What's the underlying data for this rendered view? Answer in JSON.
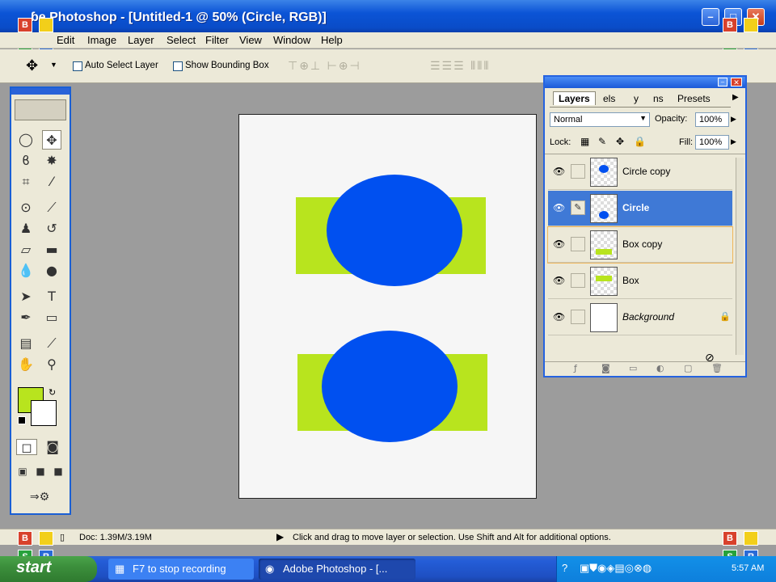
{
  "window": {
    "title": "Adobe Photoshop - [Untitled-1 @ 50% (Circle, RGB)]",
    "title_visible": "ɓe Photoshop - [Untitled-1 @ 50% (Circle, RGB)]"
  },
  "menu": [
    "Edit",
    "Image",
    "Layer",
    "Select",
    "Filter",
    "View",
    "Window",
    "Help"
  ],
  "options": {
    "auto_select_label": "Auto Select Layer",
    "show_bbox_label": "Show Bounding Box"
  },
  "badges": {
    "b": "B",
    "y": "",
    "s": "S",
    "r": "R"
  },
  "colors": {
    "foreground": "#b8e41e",
    "background": "#ffffff",
    "blue_shape": "#0050f0",
    "green_shape": "#b8e41e",
    "selection": "#3f79d6",
    "xp_blue": "#245dd7"
  },
  "layers_panel": {
    "tabs": [
      "Layers",
      "els",
      "y",
      "ns",
      "Presets"
    ],
    "blend_mode": "Normal",
    "opacity_label": "Opacity:",
    "opacity_value": "100%",
    "lock_label": "Lock:",
    "fill_label": "Fill:",
    "fill_value": "100%",
    "layers": [
      {
        "name": "Circle copy",
        "selected": false,
        "icon": "eye-icon"
      },
      {
        "name": "Circle",
        "selected": true,
        "icon": "eye-icon"
      },
      {
        "name": "Box copy",
        "selected": false,
        "icon": "eye-icon"
      },
      {
        "name": "Box",
        "selected": false,
        "icon": "eye-icon"
      },
      {
        "name": "Background",
        "selected": false,
        "icon": "eye-icon",
        "locked": true
      }
    ]
  },
  "status": {
    "doc": "Doc: 1.39M/3.19M",
    "hint": "Click and drag to move layer or selection.  Use Shift and Alt for additional options."
  },
  "taskbar": {
    "start": "start",
    "items": [
      "F7 to stop recording",
      "Adobe Photoshop - [..."
    ],
    "clock": "5:57 AM"
  }
}
